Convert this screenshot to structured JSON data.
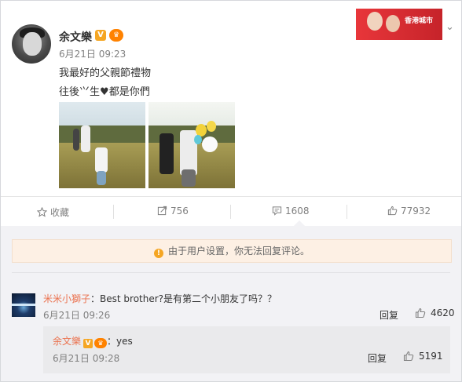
{
  "post": {
    "author": "余文樂",
    "verified_badge": "V",
    "vip_badge": "♛",
    "time": "6月21日 09:23",
    "text_line1": "我最好的父親節禮物",
    "text_line2_a": "往後",
    "text_line2_b": "⺍生",
    "text_line2_c": "都是你們",
    "heart": "♥",
    "banner_text": "香港城市"
  },
  "actions": {
    "collect_label": "收藏",
    "share_count": "756",
    "comment_count": "1608",
    "like_count": "77932"
  },
  "comments_panel": {
    "notice": "由于用户设置，你无法回复评论。",
    "comment": {
      "author": "米米小獅子",
      "text": "：Best brother?是有第二个小朋友了吗？？",
      "time": "6月21日 09:26",
      "reply_label": "回复",
      "likes": "4620"
    },
    "sub_reply": {
      "author": "余文樂",
      "text": "：yes",
      "time": "6月21日 09:28",
      "reply_label": "回复",
      "likes": "5191"
    }
  },
  "colors": {
    "link_orange": "#eb7350",
    "text_grey": "#808080",
    "badge_gold": "#f5a623"
  }
}
